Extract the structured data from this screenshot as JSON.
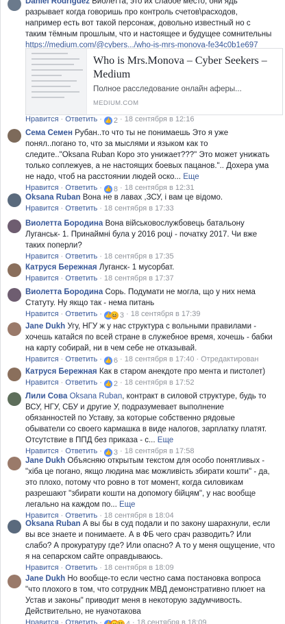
{
  "comments": [
    {
      "author": "Daniel Rodriguez",
      "text_lines": [
        "Виолетта, это их слабое место, они ядь",
        "разрывает когда говоришь про контроль счетов\\расходов,",
        "например есть вот такой персонаж, довольно известный но с",
        "таким тёмным прошлым, что и настоящее и будущее сомнительны"
      ],
      "link": "https://medium.com/@cybers.../who-is-mrs-monova-fe34c0b1e697",
      "actions": {
        "like": "Нравится",
        "reply": "Ответить",
        "reactions": "2",
        "time": "18 сентября в 12:16"
      }
    },
    {
      "author": "Сема Семен",
      "text_lines": [
        "Рубан..то что ты не понимаешь Это я уже",
        "понял..погано то, что за мыслями и языком как то",
        "следите..\"Oksana Ruban Коро это унижает???\" Это может унижать",
        "только соплежуев, а не настоящих боевых пацанов.\".. Дохера ума",
        "не надо, чтоб на расстоянии людей оско..."
      ],
      "more": "Еще",
      "actions": {
        "like": "Нравится",
        "reply": "Ответить",
        "reactions": "8",
        "time": "18 сентября в 12:31"
      }
    },
    {
      "author": "Oksana Ruban",
      "text_lines": [
        "Вона не в лавах ,ЗСУ, і вам це відомо."
      ],
      "actions": {
        "like": "Нравится",
        "reply": "Ответить",
        "reactions": "",
        "time": "18 сентября в 17:33"
      }
    },
    {
      "author": "Виолетта Бородина",
      "text_lines": [
        "Вона військовослужбовець батальону",
        "Луганськ- 1. Принаймні була у 2016 році - початку 2017. Чи вже",
        "таких поперли?"
      ],
      "actions": {
        "like": "Нравится",
        "reply": "Ответить",
        "reactions": "",
        "time": "18 сентября в 17:35"
      }
    },
    {
      "author": "Катруся Бережная",
      "text_lines": [
        "Луганск- 1 мусорбат."
      ],
      "actions": {
        "like": "Нравится",
        "reply": "Ответить",
        "reactions": "",
        "time": "18 сентября в 17:37"
      }
    },
    {
      "author": "Виолетта Бородина",
      "text_lines": [
        "Сорь. Подумати не могла, що у них нема",
        "Статуту. Ну якщо так - нема питань"
      ],
      "actions": {
        "like": "Нравится",
        "reply": "Ответить",
        "reactions": "3",
        "time": "18 сентября в 17:39"
      }
    },
    {
      "author": "Jane Dukh",
      "text_lines": [
        "Угу, НГУ ж у нас структура с вольными правилами -",
        "хочешь катайся по всей стране в служебное время, хочешь - бабки",
        "на карту собирай, ни в чем себе не отказывай."
      ],
      "actions": {
        "like": "Нравится",
        "reply": "Ответить",
        "reactions": "6",
        "time": "18 сентября в 17:40",
        "edited": "Отредактирован"
      }
    },
    {
      "author": "Катруся Бережная",
      "text_lines": [
        "Как в старом анекдоте про мента и пистолет)"
      ],
      "actions": {
        "like": "Нравится",
        "reply": "Ответить",
        "reactions": "2",
        "time": "18 сентября в 17:52"
      }
    },
    {
      "author": "Лили Сова",
      "mention": "Oksana Ruban",
      "text_lines": [
        ", контракт в силовой структуре, будь то",
        "ВСУ, НГУ, СБУ и другие У, подразумевает выполнение",
        "обязанностей по Уставу, за которые собственно рядовые",
        "обыватели со своего кармашка в виде налогов, зарплатку платят.",
        "Отсутствие в ППД без приказа - с..."
      ],
      "more": "Еще",
      "actions": {
        "like": "Нравится",
        "reply": "Ответить",
        "reactions": "3",
        "time": "18 сентября в 17:58"
      }
    },
    {
      "author": "Jane Dukh",
      "text_lines": [
        "Объясняю открытым текстом для особо понятливых -",
        "\"хіба це погано, якщо людина має можливість збирати кошти\" - да,",
        "это плохо, потому что ровно в тот момент, когда силовикам",
        "разрешают \"збирати кошти на допомогу бійцям\", у нас вообще",
        "легально на каждом по..."
      ],
      "more": "Еще",
      "actions": {
        "like": "Нравится",
        "reply": "Ответить",
        "reactions": "",
        "time": "18 сентября в 18:04"
      }
    },
    {
      "author": "Oksana Ruban",
      "text_lines": [
        "А вы бы в суд подали и по закону шарахнули, если",
        "вы все знаете и понимаете. А в ФБ чего срач разводить? Или",
        "слабо? А прокуратура? Там тоже пасут? Или где? Или вы не",
        "слабо? А прокуратуру где? Или опасно? А то у меня ощущение, что",
        "я на сепарском сайте оправдываюсь."
      ],
      "actions": {
        "like": "Нравится",
        "reply": "Ответить",
        "reactions": "",
        "time": "18 сентября в 18:09"
      }
    },
    {
      "author": "Jane Dukh",
      "text_lines": [
        "Но вообще-то если честно сама постановка вопроса",
        "\"что плохого в том, что сотрудник МВД демонстративно плюет на",
        "Устав и законы\" приводит меня в некоторую задумчивость.",
        "Действительно, не нуачотакова"
      ],
      "actions": {
        "like": "Нравится",
        "reply": "Ответить",
        "reactions": "4",
        "time": "18 сентября в 18:09"
      }
    }
  ],
  "preview": {
    "title": "Who is Mrs.Monova – Cyber Seekers – Medium",
    "description": "Полное расследование онлайн аферы...",
    "domain": "MEDIUM.COM"
  },
  "colors": {
    "link": "#385898",
    "meta": "#90949c",
    "like": "#5890ff"
  }
}
